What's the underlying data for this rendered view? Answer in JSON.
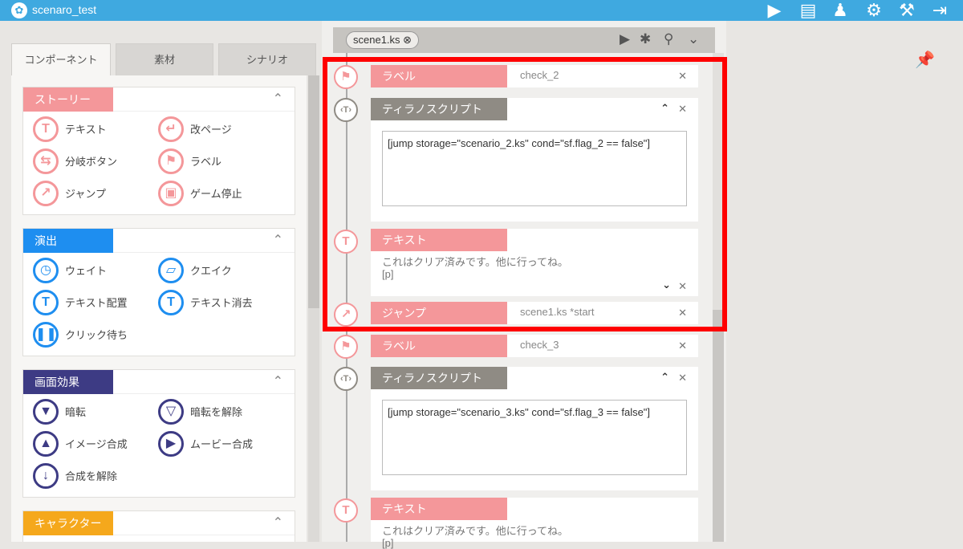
{
  "app": {
    "title": "scenaro_test"
  },
  "toolbar": {
    "icons": [
      "play-icon",
      "save-icon",
      "users-icon",
      "gear-icon",
      "hammer-icon",
      "export-icon"
    ]
  },
  "left_tabs": [
    "コンポーネント",
    "素材",
    "シナリオ"
  ],
  "categories": [
    {
      "title": "ストーリー",
      "color": "#f4979a",
      "items": [
        {
          "label": "テキスト",
          "glyph": "T"
        },
        {
          "label": "改ページ",
          "glyph": "↵"
        },
        {
          "label": "分岐ボタン",
          "glyph": "⇆"
        },
        {
          "label": "ラベル",
          "glyph": "⚑"
        },
        {
          "label": "ジャンプ",
          "glyph": "↗"
        },
        {
          "label": "ゲーム停止",
          "glyph": "▣"
        }
      ]
    },
    {
      "title": "演出",
      "color": "#1e8ef0",
      "items": [
        {
          "label": "ウェイト",
          "glyph": "◷"
        },
        {
          "label": "クエイク",
          "glyph": "▱"
        },
        {
          "label": "テキスト配置",
          "glyph": "T"
        },
        {
          "label": "テキスト消去",
          "glyph": "T"
        },
        {
          "label": "クリック待ち",
          "glyph": "❚❚"
        }
      ]
    },
    {
      "title": "画面効果",
      "color": "#3d3b84",
      "items": [
        {
          "label": "暗転",
          "glyph": "▼"
        },
        {
          "label": "暗転を解除",
          "glyph": "▽"
        },
        {
          "label": "イメージ合成",
          "glyph": "▲"
        },
        {
          "label": "ムービー合成",
          "glyph": "▶"
        },
        {
          "label": "合成を解除",
          "glyph": "↓"
        }
      ]
    },
    {
      "title": "キャラクター",
      "color": "#f5a81c",
      "items": []
    }
  ],
  "editor": {
    "file_tab": "scene1.ks ⊗",
    "blocks": [
      {
        "kind": "label",
        "title": "ラベル",
        "value": "check_2"
      },
      {
        "kind": "tyrano",
        "title": "ティラノスクリプト",
        "code": "[jump storage=\"scenario_2.ks\" cond=\"sf.flag_2 == false\"]"
      },
      {
        "kind": "text",
        "title": "テキスト",
        "line1": "これはクリア済みです。他に行ってね。",
        "line2": "[p]"
      },
      {
        "kind": "jump",
        "title": "ジャンプ",
        "value": "scene1.ks *start"
      },
      {
        "kind": "label",
        "title": "ラベル",
        "value": "check_3"
      },
      {
        "kind": "tyrano",
        "title": "ティラノスクリプト",
        "code": "[jump storage=\"scenario_3.ks\" cond=\"sf.flag_3 == false\"]"
      },
      {
        "kind": "text",
        "title": "テキスト",
        "line1": "これはクリア済みです。他に行ってね。",
        "line2": "[p]"
      }
    ]
  },
  "colors": {
    "accent": "#3fa9e0",
    "story": "#f4979a",
    "tyrano": "#8f8b84",
    "highlight": "#ff0000"
  }
}
